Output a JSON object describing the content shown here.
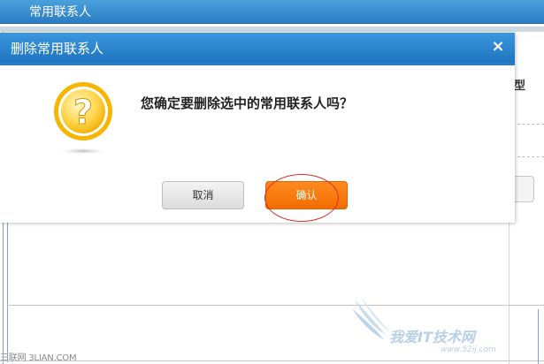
{
  "background": {
    "header_title": "常用联系人",
    "column_label_fragment": "型"
  },
  "dialog": {
    "title": "删除常用联系人",
    "close_glyph": "×",
    "message": "您确定要删除选中的常用联系人吗？",
    "cancel_label": "取消",
    "confirm_label": "确认"
  },
  "watermarks": {
    "left": "三联网 3LIAN.COM",
    "right": "我爱IT技术网",
    "url": "www.52ij.com"
  },
  "colors": {
    "titlebar": "#2a7cc4",
    "confirm": "#f57a0e",
    "icon": "#f7b500"
  },
  "icons": {
    "dialog": "question-mark-icon",
    "close": "close-icon"
  }
}
